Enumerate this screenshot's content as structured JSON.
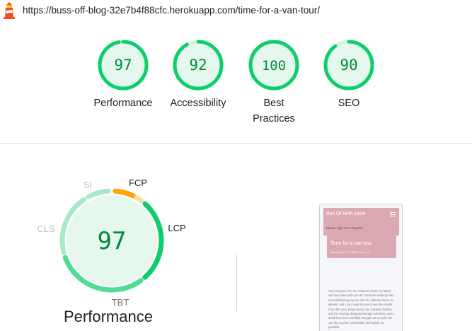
{
  "url_bar": {
    "url": "https://buss-off-blog-32e7b4f88cfc.herokuapp.com/time-for-a-van-tour/",
    "logo_icon": "lighthouse-icon"
  },
  "categories": [
    {
      "score": "97",
      "label": "Performance",
      "fraction": 0.97,
      "color": "#0cce6b"
    },
    {
      "score": "92",
      "label": "Accessibility",
      "fraction": 0.92,
      "color": "#0cce6b"
    },
    {
      "score": "100",
      "label": "Best Practices",
      "fraction": 1.0,
      "color": "#0cce6b"
    },
    {
      "score": "90",
      "label": "SEO",
      "fraction": 0.9,
      "color": "#0cce6b"
    }
  ],
  "performance_gauge": {
    "score": "97",
    "title": "Performance",
    "metrics": {
      "si": "SI",
      "fcp": "FCP",
      "lcp": "LCP",
      "tbt": "TBT",
      "cls": "CLS"
    },
    "colors": {
      "pass": "#0cce6b",
      "average": "#ffa400",
      "pass_light": "#a9e9c8",
      "bg": "#e6f8ee"
    }
  },
  "preview": {
    "brand": "Bus Of With Josie",
    "login_text": "Please Sign In or Register",
    "post_title": "Time for a van tour",
    "post_meta": "Josie | Sept. 17, 2023, 9:12 p.m.",
    "body_text": "Hey everyone! I'm so excited to share my latest van tour video with you all. I've been working hard on transforming my van into the ultimate home on wheels, and I can't wait for you to see the results. From the cozy living area to the compact kitchen and the cleverly designed storage solutions, every detail has been carefully thought out to make the van life road as comfortable and stylish as possible."
  }
}
